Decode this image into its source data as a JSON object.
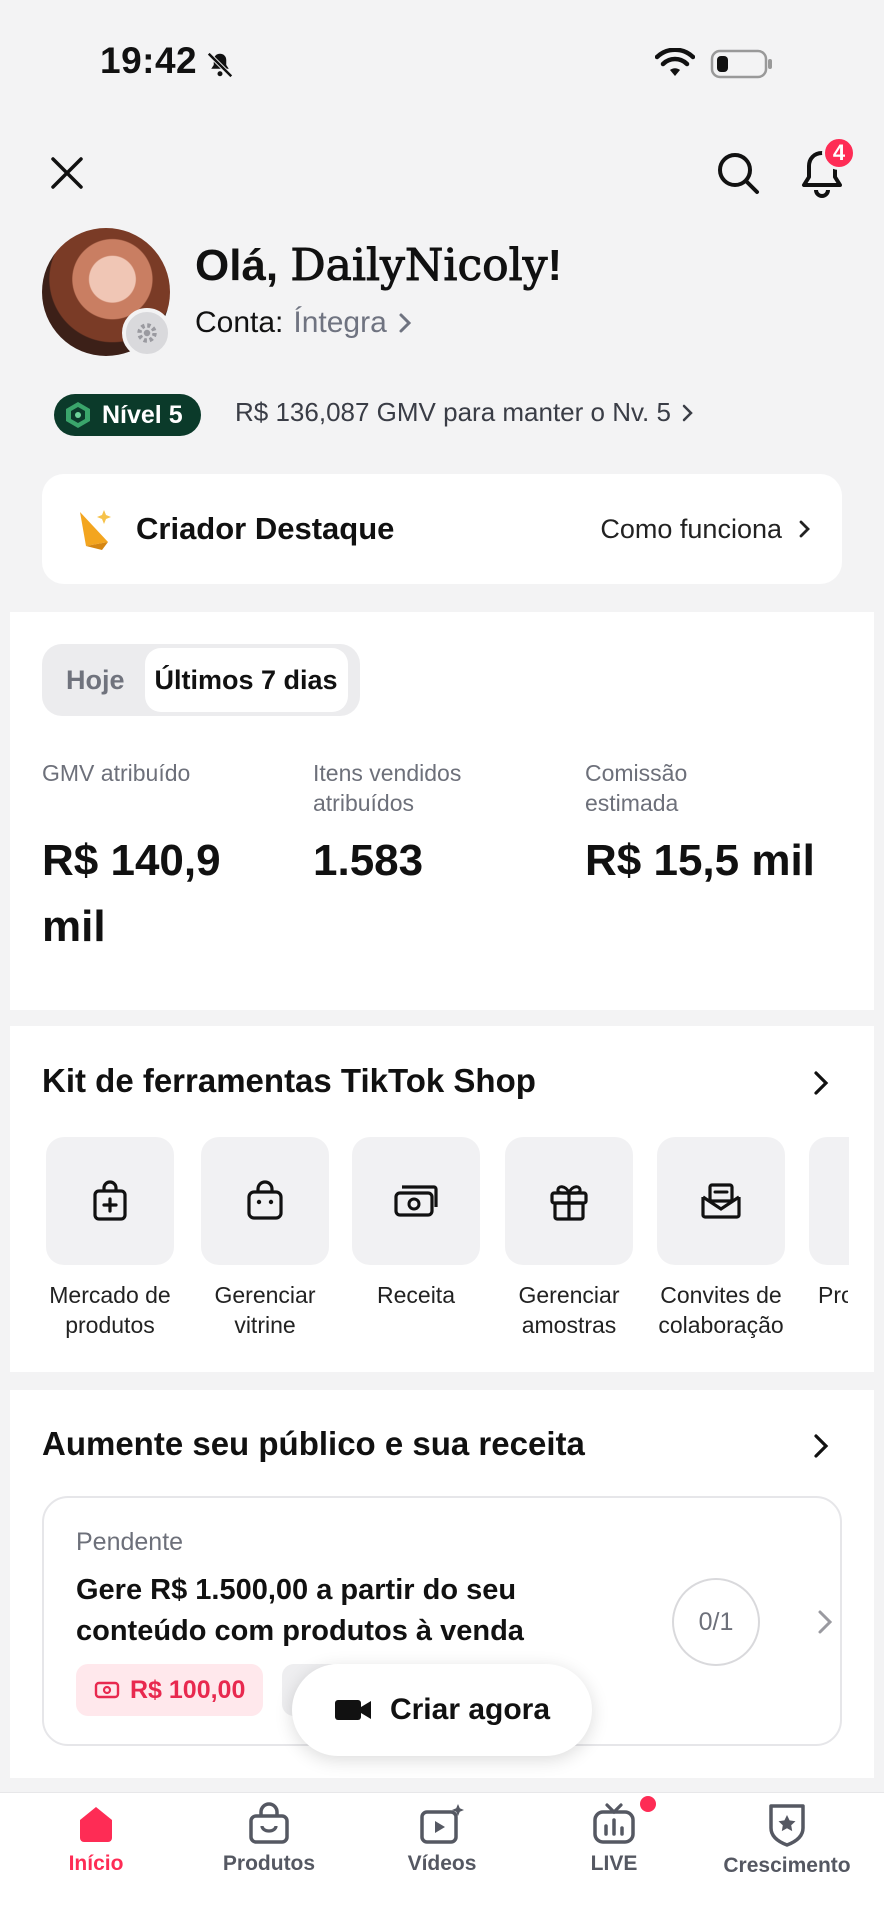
{
  "status_bar": {
    "time": "19:42"
  },
  "header": {
    "notification_count": "4"
  },
  "profile": {
    "greeting_prefix": "Olá, ",
    "name": "DailyNicoly",
    "greeting_suffix": "!",
    "account_label": "Conta:",
    "account_value": "Íntegra"
  },
  "level": {
    "badge": "Nível 5",
    "note": "R$ 136,087 GMV para manter o Nv. 5"
  },
  "destaque": {
    "title": "Criador Destaque",
    "link": "Como funciona"
  },
  "stats": {
    "tabs": [
      {
        "label": "Hoje",
        "active": false
      },
      {
        "label": "Últimos 7 dias",
        "active": true
      }
    ],
    "metrics": [
      {
        "label": "GMV atribuído",
        "value_line1": "R$ 140,9",
        "value_line2": "mil"
      },
      {
        "label": "Itens vendidos atribuídos",
        "value_line1": "1.583",
        "value_line2": ""
      },
      {
        "label": "Comissão estimada",
        "value_line1": "R$ 15,5 mil",
        "value_line2": ""
      }
    ]
  },
  "tools": {
    "title": "Kit de ferramentas TikTok Shop",
    "items": [
      {
        "line1": "Mercado de",
        "line2": "produtos",
        "icon": "bag-plus-icon"
      },
      {
        "line1": "Gerenciar",
        "line2": "vitrine",
        "icon": "shop-bag-icon"
      },
      {
        "line1": "Receita",
        "line2": "",
        "icon": "money-icon"
      },
      {
        "line1": "Gerenciar",
        "line2": "amostras",
        "icon": "gift-icon"
      },
      {
        "line1": "Convites de",
        "line2": "colaboração",
        "icon": "envelope-icon"
      },
      {
        "line1": "Pro",
        "line2": "",
        "icon": "more-icon"
      }
    ]
  },
  "growth": {
    "title": "Aumente seu público e sua receita",
    "task": {
      "status": "Pendente",
      "description": "Gere R$ 1.500,00 a partir do seu conteúdo com produtos à venda",
      "reward": "R$ 100,00",
      "progress": "0/1"
    },
    "create_button": "Criar agora"
  },
  "tabbar": [
    {
      "label": "Início",
      "active": true
    },
    {
      "label": "Produtos",
      "active": false
    },
    {
      "label": "Vídeos",
      "active": false
    },
    {
      "label": "LIVE",
      "active": false
    },
    {
      "label": "Crescimento",
      "active": false
    }
  ],
  "colors": {
    "accent": "#fe2c55",
    "level_bg": "#0b3a2a"
  }
}
